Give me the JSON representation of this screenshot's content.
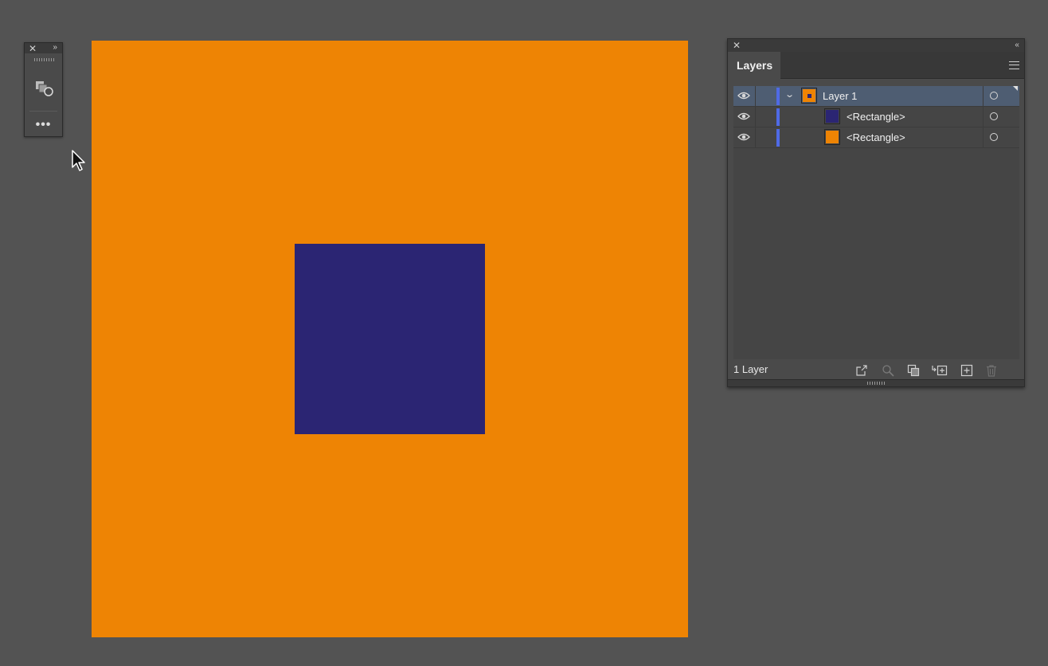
{
  "canvas": {
    "artboard_color": "#ee8404",
    "rect_color": "#2b2573"
  },
  "mini_panel": {
    "close_icon": "close-icon",
    "collapse_icon": "double-chevron-right-icon",
    "tool_icon": "shape-builder-icon",
    "more_label": "•••"
  },
  "layers_panel": {
    "tab_label": "Layers",
    "collapse_icon": "double-chevron-left-icon",
    "menu_icon": "hamburger-menu-icon",
    "layer_color": "#4f6ae6",
    "rows": [
      {
        "name": "Layer 1",
        "thumb_color": "#ee8404",
        "selected": true
      },
      {
        "name": "<Rectangle>",
        "thumb_color": "#2b2573",
        "selected": false
      },
      {
        "name": "<Rectangle>",
        "thumb_color": "#ee8404",
        "selected": false
      }
    ],
    "footer": {
      "count_label": "1 Layer",
      "buttons": [
        "export-icon",
        "locate-object-icon",
        "clipping-mask-icon",
        "create-sublayer-icon",
        "new-layer-icon",
        "trash-icon"
      ]
    }
  }
}
